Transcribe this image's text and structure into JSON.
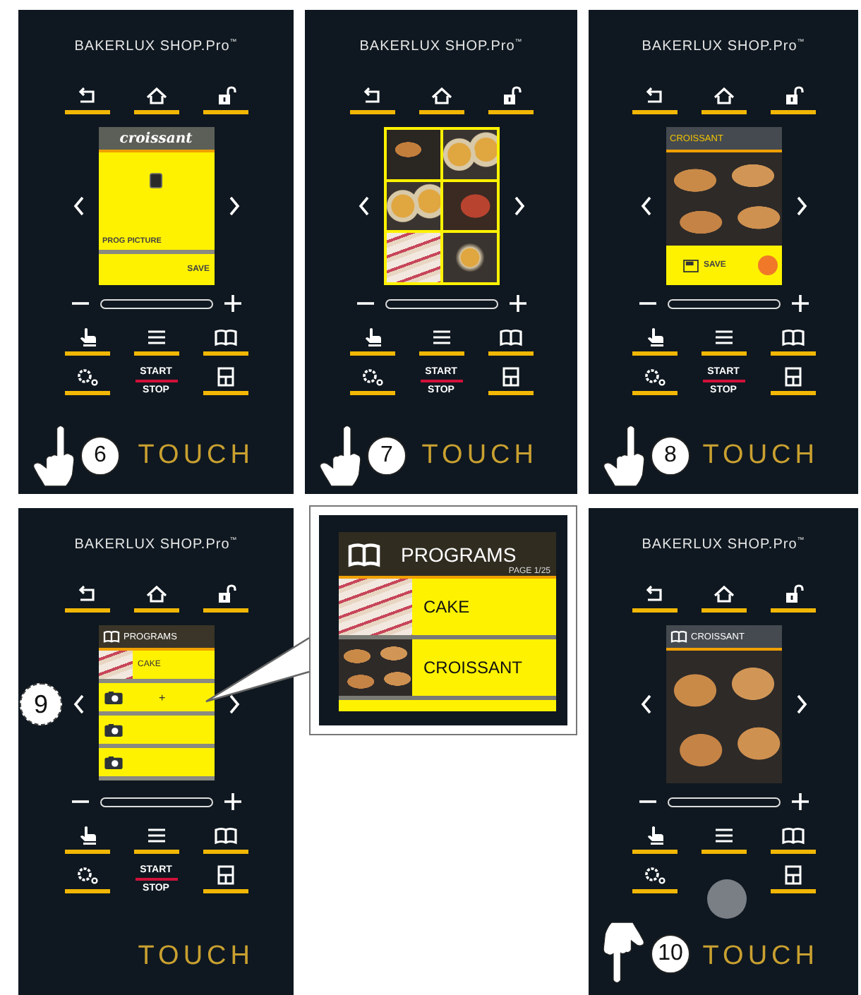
{
  "panels": [
    {
      "kind": "name_edit",
      "brand": "BAKERLUX SHOP.Pro$^{™}$",
      "screen": {
        "title": "croissant",
        "picture_label": "PROG PICTURE",
        "save": "SAVE"
      },
      "start": "START",
      "stop": "STOP",
      "logo": "TOUCH",
      "pointer": {
        "kind": "hand",
        "step": "6"
      }
    },
    {
      "kind": "picture_grid",
      "brand": "BAKERLUX SHOP.Pro$^{™}$",
      "start": "START",
      "stop": "STOP",
      "logo": "TOUCH",
      "pointer": {
        "kind": "hand",
        "step": "7"
      }
    },
    {
      "kind": "picture_save",
      "brand": "BAKERLUX SHOP.Pro$^{™}$",
      "screen": {
        "title": "CROISSANT",
        "save": "SAVE"
      },
      "start": "START",
      "stop": "STOP",
      "logo": "TOUCH",
      "pointer": {
        "kind": "hand_tap",
        "step": "8"
      }
    },
    {
      "kind": "program_list",
      "brand": "BAKERLUX SHOP.Pro$^{™}$",
      "screen": {
        "title": "PROGRAMS",
        "rows": [
          {
            "kind": "photo",
            "label": "CAKE"
          },
          {
            "kind": "camera",
            "label": "+"
          },
          {
            "kind": "camera"
          },
          {
            "kind": "camera"
          }
        ]
      },
      "start": "START",
      "stop": "STOP",
      "logo": "TOUCH",
      "pointer": {
        "kind": "circle",
        "step": "9"
      }
    },
    {
      "kind": "program_view",
      "brand": "BAKERLUX SHOP.Pro$^{™}$",
      "screen": {
        "title": "CROISSANT"
      },
      "logo": "TOUCH",
      "pointer": {
        "kind": "hand_down",
        "step": "10"
      }
    }
  ],
  "callout": {
    "title": "PROGRAMS",
    "page": "PAGE 1/25",
    "rows": [
      {
        "label": "CAKE"
      },
      {
        "label": "CROISSANT"
      }
    ]
  }
}
